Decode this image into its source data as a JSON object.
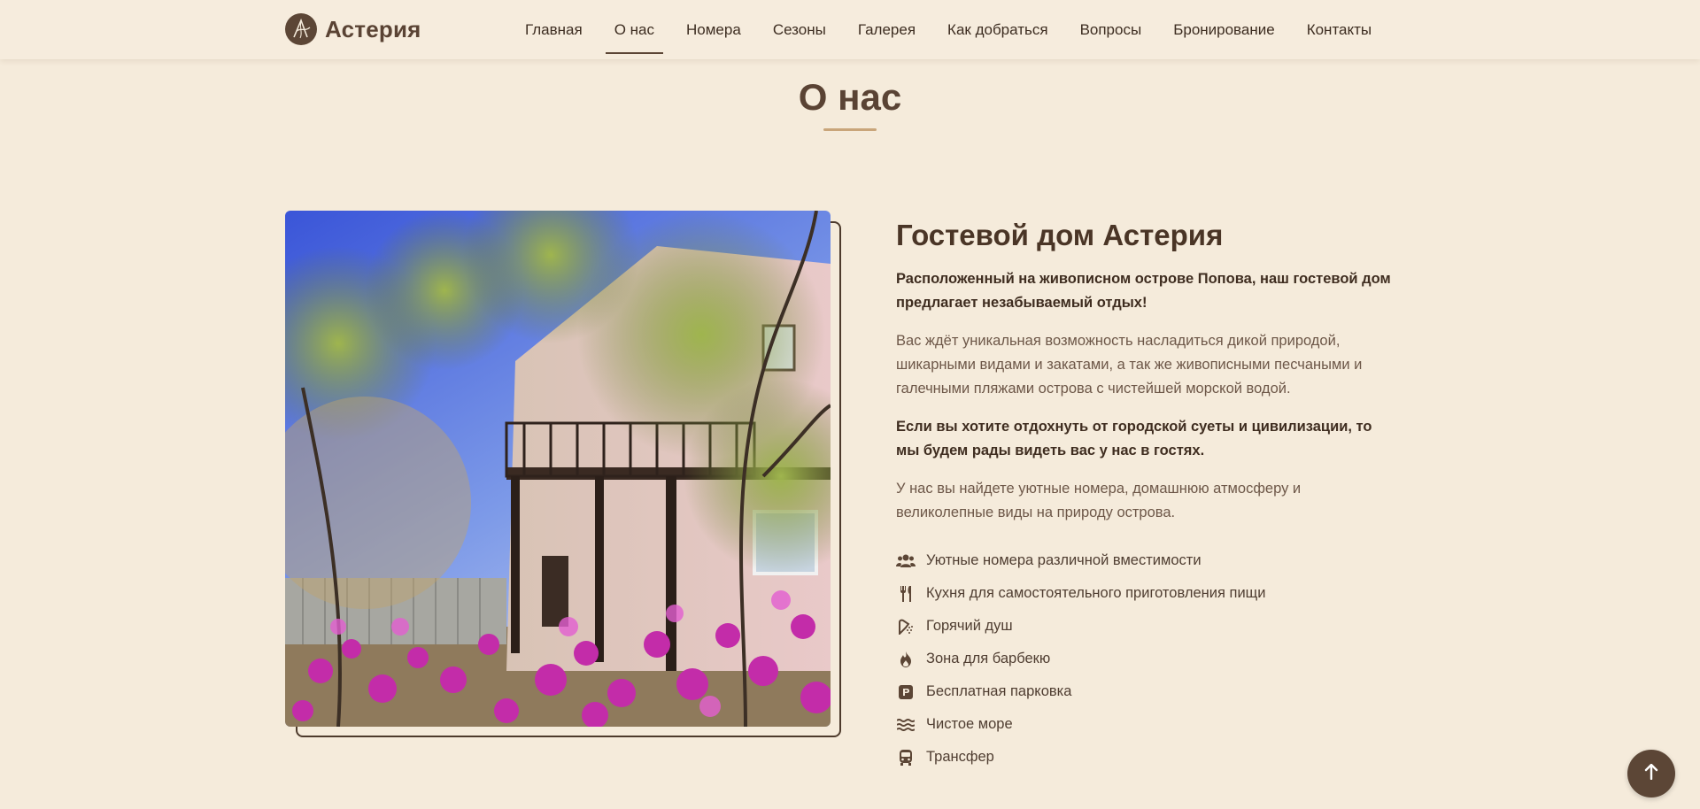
{
  "header": {
    "brand": "Астерия",
    "nav": [
      {
        "label": "Главная",
        "active": false
      },
      {
        "label": "О нас",
        "active": true
      },
      {
        "label": "Номера",
        "active": false
      },
      {
        "label": "Сезоны",
        "active": false
      },
      {
        "label": "Галерея",
        "active": false
      },
      {
        "label": "Как добраться",
        "active": false
      },
      {
        "label": "Вопросы",
        "active": false
      },
      {
        "label": "Бронирование",
        "active": false
      },
      {
        "label": "Контакты",
        "active": false
      }
    ]
  },
  "section": {
    "title": "О нас"
  },
  "about": {
    "heading": "Гостевой дом Астерия",
    "intro_bold": "Расположенный на живописном острове Попова, наш гостевой дом предлагает незабываемый отдых!",
    "paragraph_1": "Вас ждёт уникальная возможность насладиться дикой природой, шикарными видами и закатами, а так же живописными песчаными и галечными пляжами острова с чистейшей морской водой.",
    "invite_bold": "Если вы хотите отдохнуть от городской суеты и цивилизации, то мы будем рады видеть вас у нас в гостях.",
    "paragraph_2": "У нас вы найдете уютные номера, домашнюю атмосферу и великолепные виды на природу острова.",
    "features": [
      {
        "icon": "users-icon",
        "label": "Уютные номера различной вместимости"
      },
      {
        "icon": "utensils-icon",
        "label": "Кухня для самостоятельного приготовления пищи"
      },
      {
        "icon": "shower-icon",
        "label": "Горячий душ"
      },
      {
        "icon": "fire-icon",
        "label": "Зона для барбекю"
      },
      {
        "icon": "parking-icon",
        "label": "Бесплатная парковка"
      },
      {
        "icon": "water-icon",
        "label": "Чистое море"
      },
      {
        "icon": "bus-icon",
        "label": "Трансфер"
      }
    ]
  },
  "colors": {
    "background": "#f5ebdb",
    "brand_brown": "#5c4636",
    "accent_gold": "#c9a57a"
  }
}
